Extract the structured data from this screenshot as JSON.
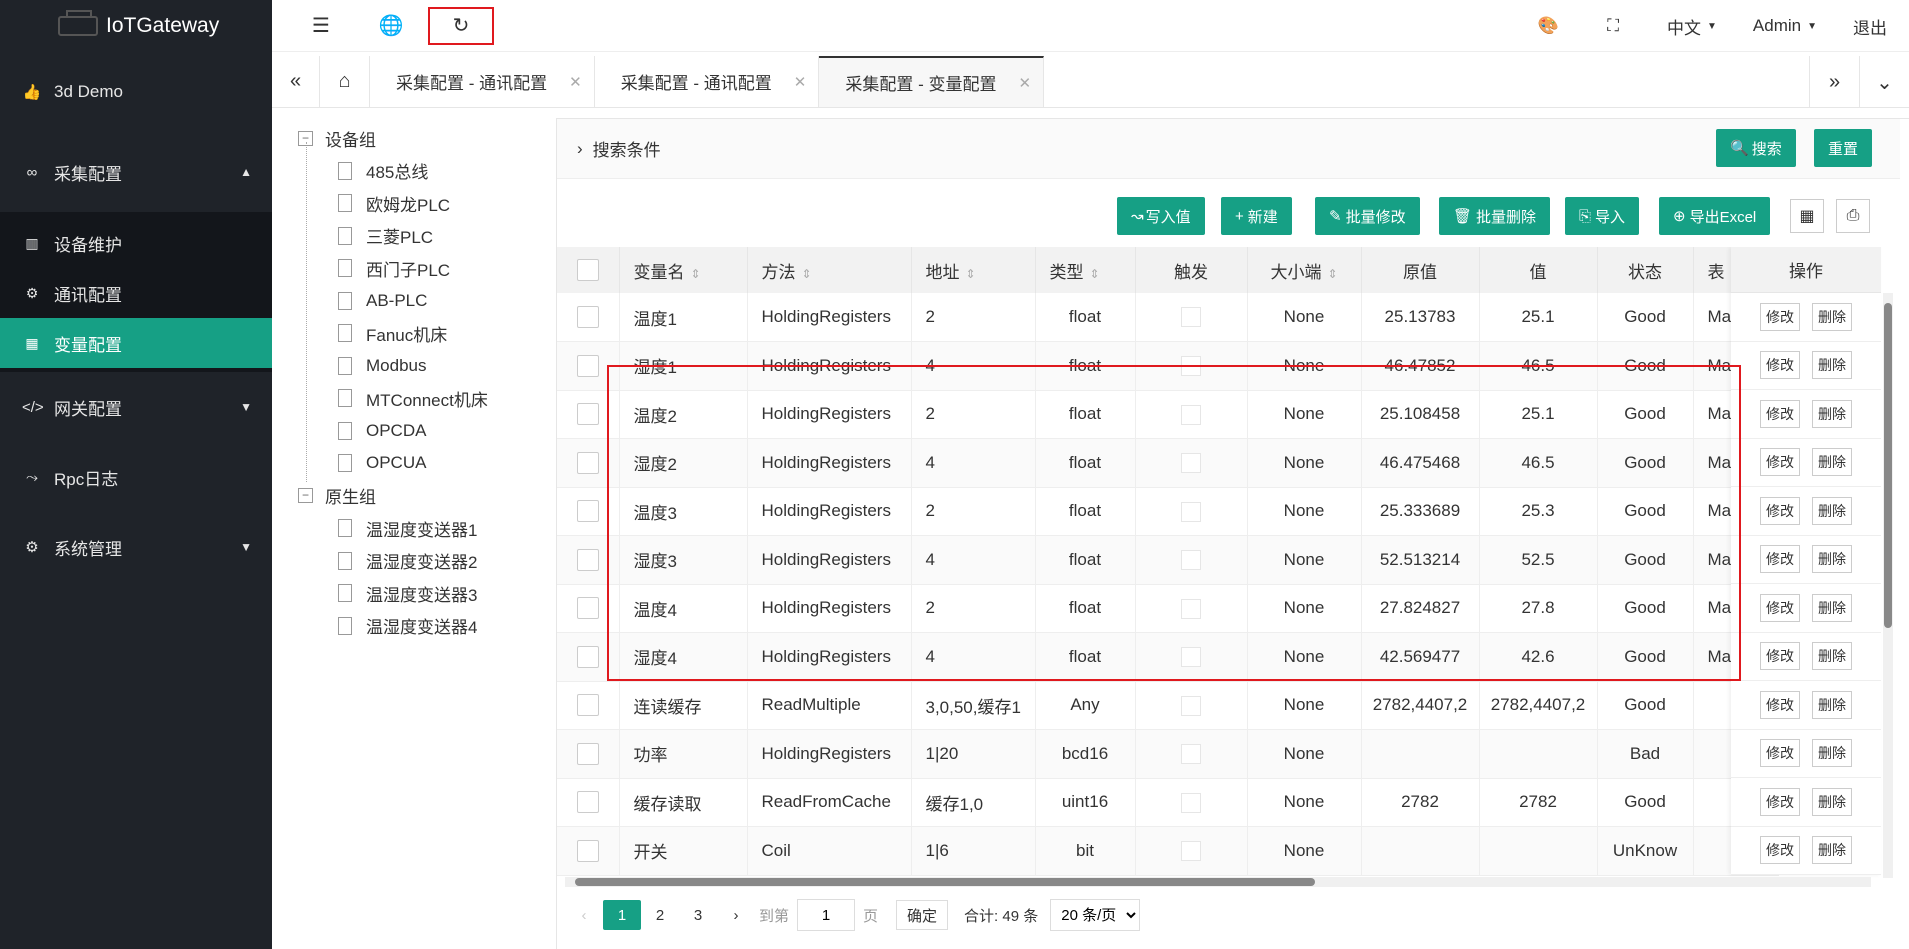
{
  "app": {
    "title": "IoTGateway"
  },
  "sidebar": {
    "items": [
      {
        "label": "3d Demo",
        "icon": "thumbs-up-icon"
      },
      {
        "label": "采集配置",
        "icon": "infinity-icon",
        "expanded": true,
        "children": [
          {
            "label": "设备维护",
            "icon": "device-icon"
          },
          {
            "label": "通讯配置",
            "icon": "gear-icon"
          },
          {
            "label": "变量配置",
            "icon": "grid-icon",
            "active": true
          }
        ]
      },
      {
        "label": "网关配置",
        "icon": "code-icon"
      },
      {
        "label": "Rpc日志",
        "icon": "wave-icon"
      },
      {
        "label": "系统管理",
        "icon": "gear-icon"
      }
    ]
  },
  "header": {
    "language": "中文",
    "user": "Admin",
    "logout": "退出"
  },
  "tabs": [
    {
      "label": "采集配置 - 通讯配置",
      "active": false
    },
    {
      "label": "采集配置 - 通讯配置",
      "active": false
    },
    {
      "label": "采集配置 - 变量配置",
      "active": true
    }
  ],
  "tree": {
    "groups": [
      {
        "label": "设备组",
        "children": [
          "485总线",
          "欧姆龙PLC",
          "三菱PLC",
          "西门子PLC",
          "AB-PLC",
          "Fanuc机床",
          "Modbus",
          "MTConnect机床",
          "OPCDA",
          "OPCUA"
        ]
      },
      {
        "label": "原生组",
        "children": [
          "温湿度变送器1",
          "温湿度变送器2",
          "温湿度变送器3",
          "温湿度变送器4"
        ]
      }
    ]
  },
  "search": {
    "title": "搜索条件",
    "search_btn": "搜索",
    "reset_btn": "重置"
  },
  "toolbar": {
    "write": "写入值",
    "new": "新建",
    "batch_edit": "批量修改",
    "batch_delete": "批量删除",
    "import": "导入",
    "export": "导出Excel"
  },
  "table": {
    "columns": [
      "变量名",
      "方法",
      "地址",
      "类型",
      "触发",
      "大小端",
      "原值",
      "值",
      "状态",
      "表",
      "操作"
    ],
    "rows": [
      [
        "温度1",
        "HoldingRegisters",
        "2",
        "float",
        "None",
        "25.13783",
        "25.1",
        "Good",
        "Ma"
      ],
      [
        "湿度1",
        "HoldingRegisters",
        "4",
        "float",
        "None",
        "46.47852",
        "46.5",
        "Good",
        "Ma"
      ],
      [
        "温度2",
        "HoldingRegisters",
        "2",
        "float",
        "None",
        "25.108458",
        "25.1",
        "Good",
        "Ma"
      ],
      [
        "湿度2",
        "HoldingRegisters",
        "4",
        "float",
        "None",
        "46.475468",
        "46.5",
        "Good",
        "Ma"
      ],
      [
        "温度3",
        "HoldingRegisters",
        "2",
        "float",
        "None",
        "25.333689",
        "25.3",
        "Good",
        "Ma"
      ],
      [
        "湿度3",
        "HoldingRegisters",
        "4",
        "float",
        "None",
        "52.513214",
        "52.5",
        "Good",
        "Ma"
      ],
      [
        "温度4",
        "HoldingRegisters",
        "2",
        "float",
        "None",
        "27.824827",
        "27.8",
        "Good",
        "Ma"
      ],
      [
        "湿度4",
        "HoldingRegisters",
        "4",
        "float",
        "None",
        "42.569477",
        "42.6",
        "Good",
        "Ma"
      ],
      [
        "连读缓存",
        "ReadMultiple",
        "3,0,50,缓存1",
        "Any",
        "None",
        "2782,4407,2",
        "2782,4407,2",
        "Good",
        ""
      ],
      [
        "功率",
        "HoldingRegisters",
        "1|20",
        "bcd16",
        "None",
        "",
        "",
        "Bad",
        ""
      ],
      [
        "缓存读取",
        "ReadFromCache",
        "缓存1,0",
        "uint16",
        "None",
        "2782",
        "2782",
        "Good",
        ""
      ],
      [
        "开关",
        "Coil",
        "1|6",
        "bit",
        "None",
        "",
        "",
        "UnKnow",
        ""
      ]
    ],
    "edit_label": "修改",
    "delete_label": "删除"
  },
  "pager": {
    "pages": [
      "1",
      "2",
      "3"
    ],
    "goto_label": "到第",
    "goto_value": "1",
    "page_unit": "页",
    "confirm": "确定",
    "total": "合计: 49 条",
    "page_size": "20 条/页"
  },
  "colors": {
    "accent": "#16a085",
    "sidebar_bg": "#1f2329",
    "highlight": "#e0191e"
  }
}
